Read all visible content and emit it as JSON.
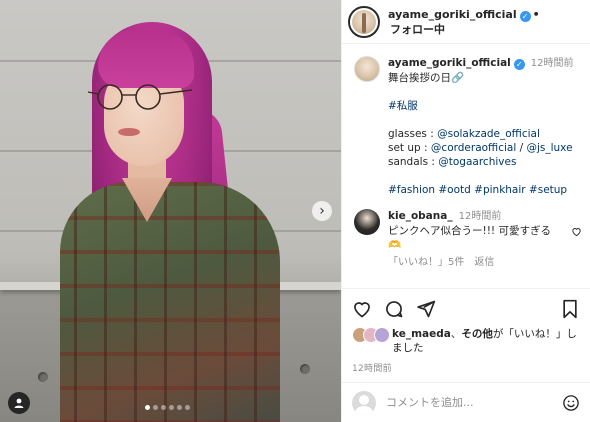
{
  "account": {
    "username": "ayame_goriki_official",
    "follow_status": "フォロー中",
    "dot": "•"
  },
  "caption": {
    "username": "ayame_goriki_official",
    "time": "12時間前",
    "line1": "舞台挨拶の日🔗",
    "tag_main": "#私服",
    "glasses_label": "glasses : ",
    "glasses_mention": "@solakzade_official",
    "setup_label": "set up : ",
    "setup_mention_1": "@corderaofficial",
    "setup_sep": " / ",
    "setup_mention_2": "@js_luxe",
    "sandals_label": "sandals : ",
    "sandals_mention": "@togaarchives",
    "hashtags": "#fashion #ootd #pinkhair #setup"
  },
  "comment": {
    "username": "kie_obana_",
    "time": "12時間前",
    "text": "ピンクヘア似合うー!!! 可愛すぎる🫶",
    "text_cont": "🫶",
    "likes": "「いいね！」5件",
    "reply": "返信"
  },
  "likes": {
    "user": "ke_maeda",
    "connector": "、",
    "others": "その他",
    "suffix": "が「いいね！」しました"
  },
  "post_time": "12時間前",
  "add_comment": {
    "placeholder": "コメントを追加..."
  },
  "carousel": {
    "slide_count": 6,
    "active_index": 0
  },
  "colors": {
    "verified": "#3897f0",
    "link": "#00376b",
    "hair": "#c23a96"
  },
  "icons": {
    "like": "heart-icon",
    "comment": "comment-icon",
    "share": "share-icon",
    "save": "bookmark-icon",
    "next": "chevron-right-icon",
    "emoji": "emoji-icon",
    "tag": "user-tag-icon"
  }
}
